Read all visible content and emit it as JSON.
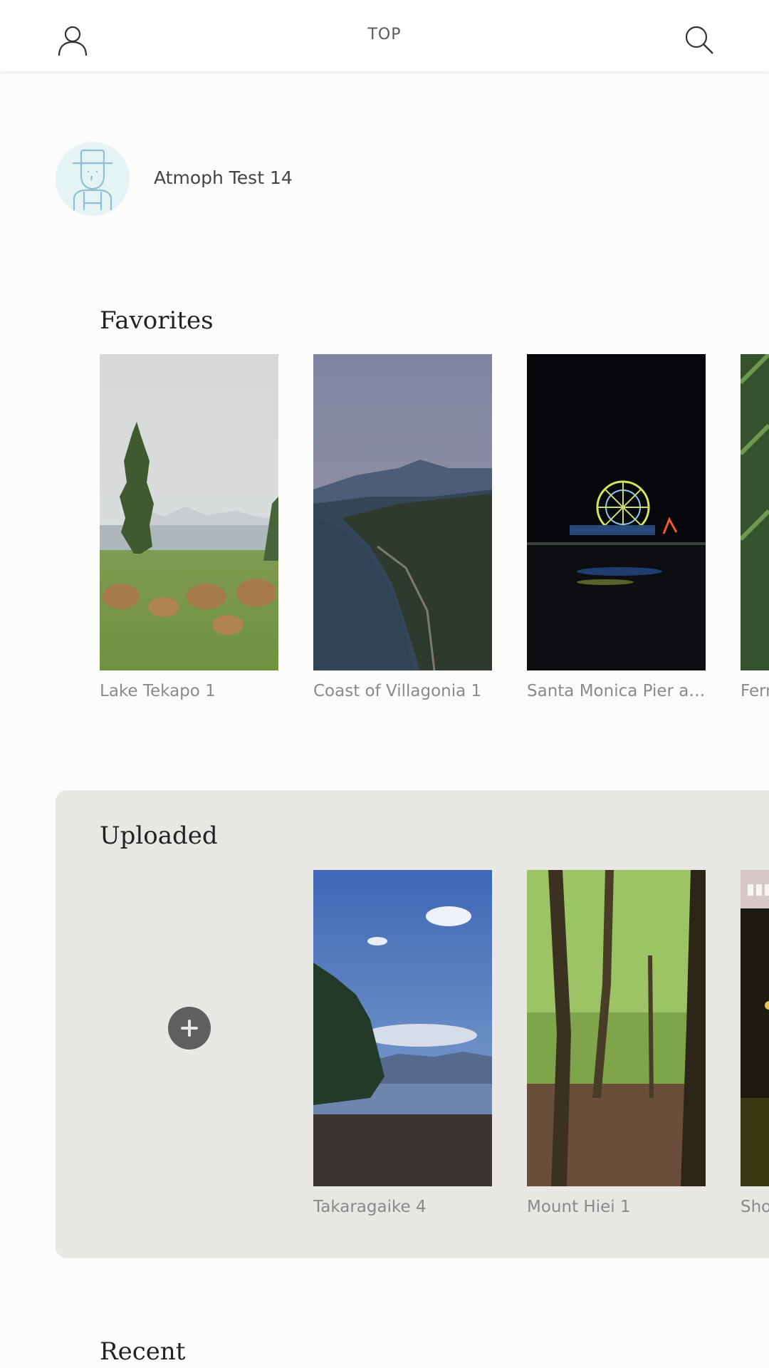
{
  "header": {
    "title": "TOP",
    "profile_icon": "person-icon",
    "search_icon": "search-icon"
  },
  "user": {
    "name": "Atmoph Test 14",
    "avatar_icon": "explorer-avatar-icon"
  },
  "favorites": {
    "title": "Favorites",
    "items": [
      {
        "label": "Lake Tekapo 1"
      },
      {
        "label": "Coast of Villagonia 1"
      },
      {
        "label": "Santa Monica Pier at..."
      },
      {
        "label": "Fern"
      }
    ]
  },
  "uploaded": {
    "title": "Uploaded",
    "add_icon": "plus-icon",
    "items": [
      {
        "label": "Takaragaike 4"
      },
      {
        "label": "Mount Hiei 1"
      },
      {
        "label": "Sho"
      }
    ]
  },
  "recent": {
    "title": "Recent"
  },
  "colors": {
    "panel": "#e8e7e3",
    "caption": "#8a8a8a",
    "avatar_bg": "#e6f3f5",
    "avatar_line": "#8fbfd2"
  }
}
